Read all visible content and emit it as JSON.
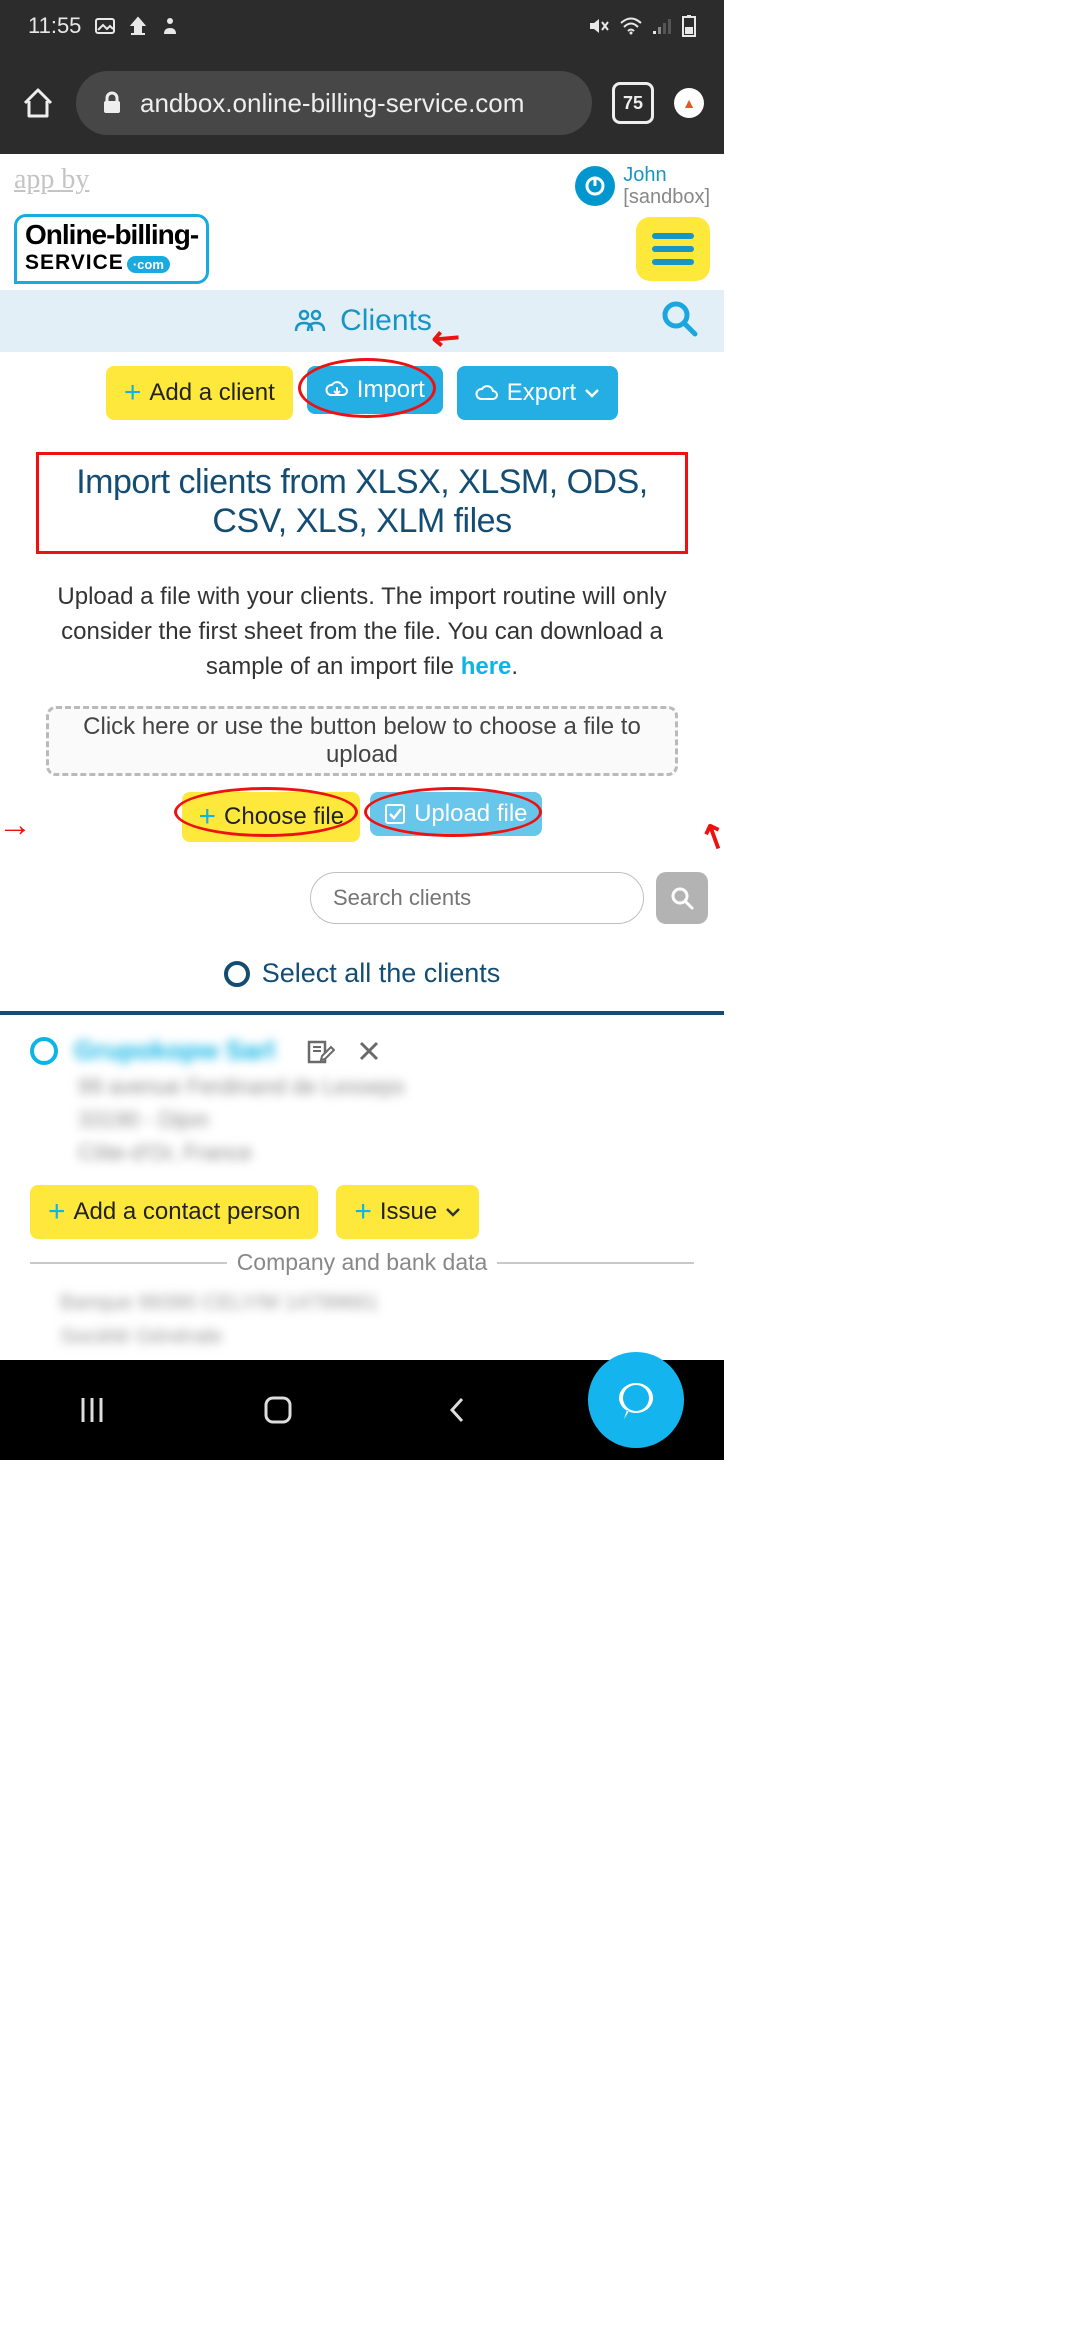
{
  "status": {
    "time": "11:55"
  },
  "browser": {
    "url": "andbox.online-billing-service.com",
    "tab_count": "75"
  },
  "header": {
    "app_by": "app by",
    "user_name": "John",
    "user_env": "[sandbox]",
    "logo_line1": "Online-billing-",
    "logo_line2": "SeRVICe",
    "logo_badge": "·com"
  },
  "section": {
    "title": "Clients"
  },
  "actions": {
    "add_client": "Add a client",
    "import": "Import",
    "export": "Export"
  },
  "import_panel": {
    "title": "Import clients from XLSX, XLSM, ODS, CSV, XLS, XLM files",
    "desc_part1": "Upload a file with your clients. The import routine will only consider the first sheet from the file. You can download a sample of an import file ",
    "here": "here",
    "desc_part2": ".",
    "dropzone": "Click here or use the button below to choose a file to upload",
    "choose_file": "Choose file",
    "upload_file": "Upload file"
  },
  "search": {
    "placeholder": "Search clients"
  },
  "select_all": "Select all the clients",
  "client": {
    "name": "Grupokopw Sarl",
    "line1": "99 avenue Ferdinand de Lesseps",
    "line2": "33190 - Dijon",
    "line3": "Côte-d'Or, France",
    "add_contact": "Add a contact person",
    "issue": "Issue",
    "section_label": "Company and bank data",
    "bank1": "Banque 99390 CELY/M 14799661",
    "bank2": "Société Générale"
  }
}
